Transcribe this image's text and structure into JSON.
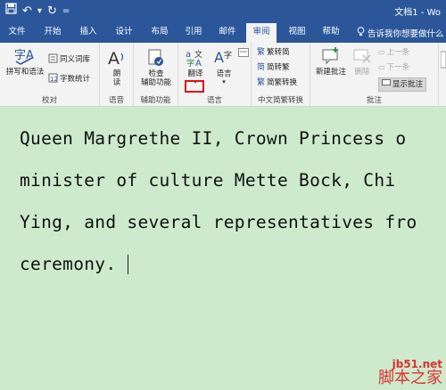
{
  "titlebar": {
    "doc_title": "文档1 - Wo",
    "qat": {
      "save_icon": "save-icon",
      "undo_glyph": "↶",
      "undo_dropdown": "▾",
      "redo_glyph": "↻",
      "customize": "="
    }
  },
  "tabs": [
    "文件",
    "开始",
    "插入",
    "设计",
    "布局",
    "引用",
    "邮件",
    "审阅",
    "视图",
    "帮助"
  ],
  "active_tab": "审阅",
  "tell_me": "告诉我你想要做什么",
  "ribbon": {
    "proofing": {
      "label": "校对",
      "spelling": "拼写和语法",
      "thesaurus": "同义词库",
      "word_count": "字数统计",
      "spelling_glyph": "字A"
    },
    "speech": {
      "label": "语音",
      "read_aloud_1": "朗",
      "read_aloud_2": "读"
    },
    "accessibility": {
      "label": "辅助功能",
      "check_1": "检查",
      "check_2": "辅助功能"
    },
    "language": {
      "label": "语言",
      "translate": "翻译",
      "language": "语言"
    },
    "chinese_conversion": {
      "label": "中文简繁转换",
      "to_traditional": "繁转简",
      "to_simplified": "简转繁",
      "conversion": "简繁转换"
    },
    "comments": {
      "label": "批注",
      "new_comment": "新建批注",
      "delete": "删除",
      "previous": "上一条",
      "next": "下一条",
      "show_comments": "显示批注"
    }
  },
  "document": {
    "lines": [
      "Queen Margrethe II, Crown Princess o",
      "minister of culture Mette Bock, Chi",
      "Ying, and several representatives fro",
      "ceremony."
    ]
  },
  "watermark": {
    "site": "jb51.net",
    "brand": "脚本之家"
  },
  "colors": {
    "title_blue": "#2b579a",
    "doc_bg": "#cdeacd",
    "ribbon_bg": "#f3f3f3",
    "highlight_red": "#e01010"
  }
}
